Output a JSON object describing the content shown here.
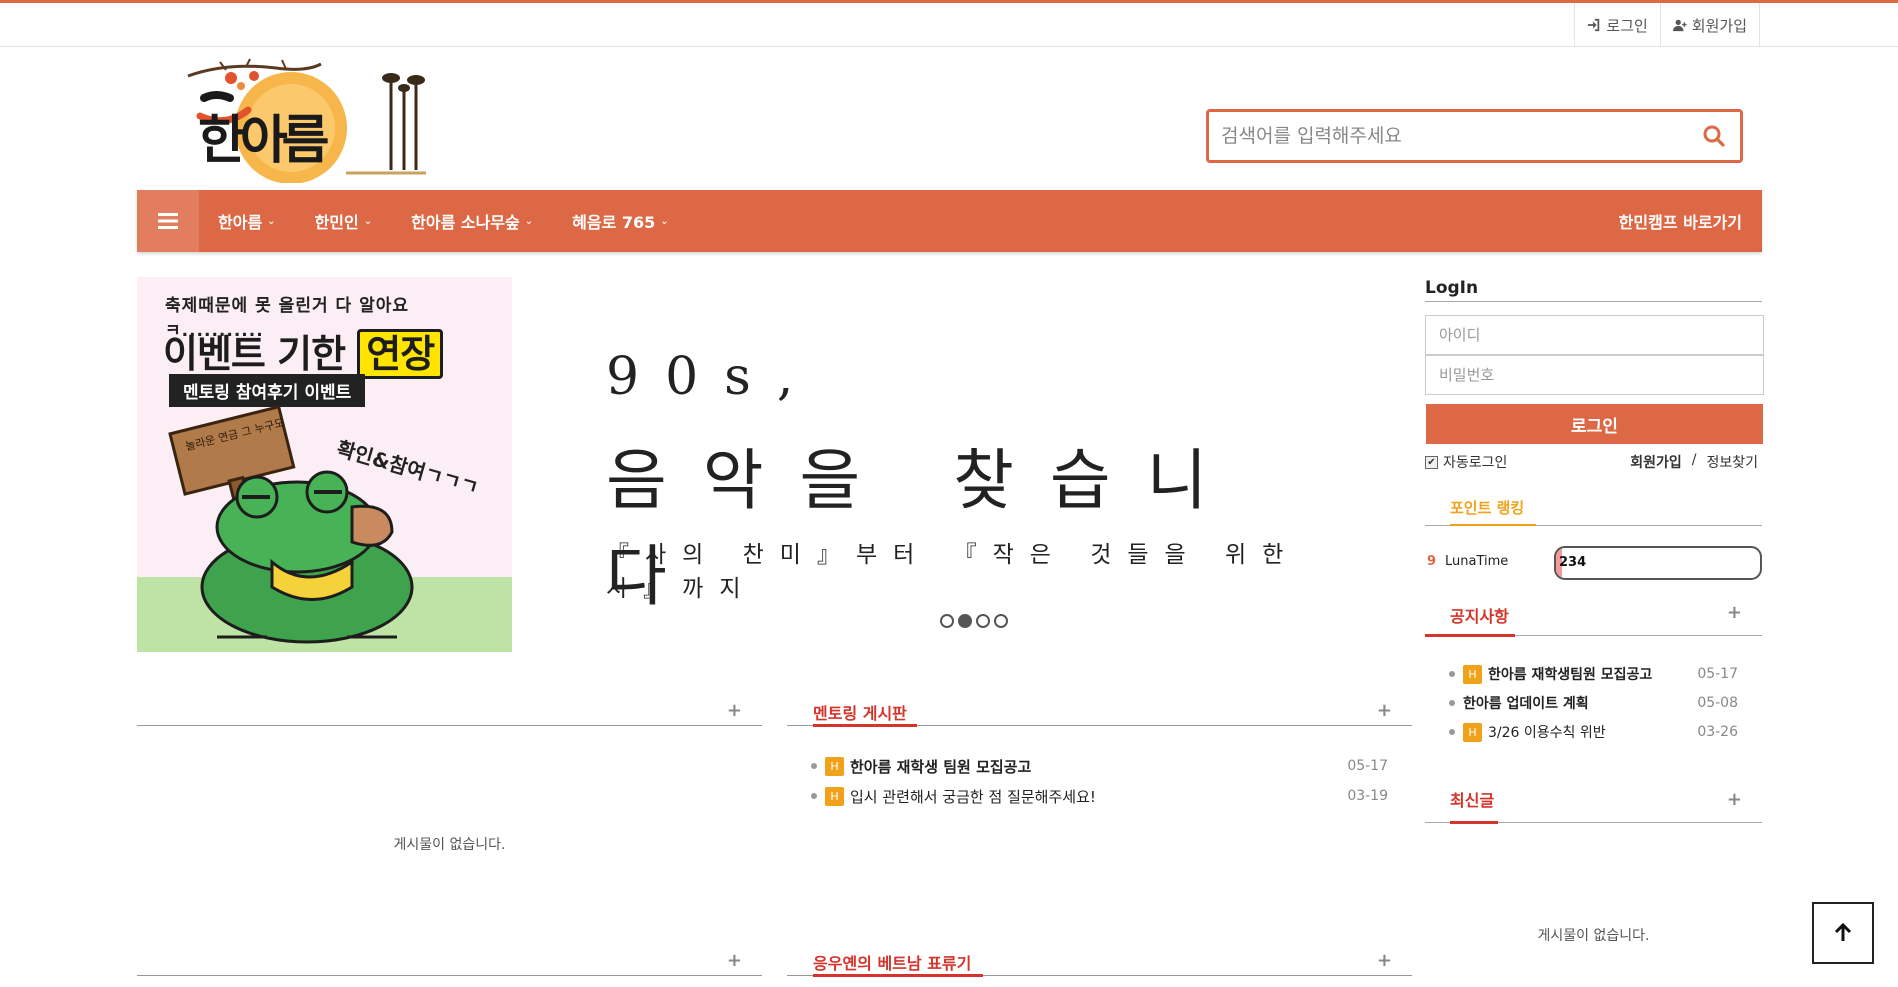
{
  "topbar": {
    "login_label": "로그인",
    "signup_label": "회원가입"
  },
  "search": {
    "placeholder": "검색어를 입력해주세요"
  },
  "nav": {
    "items": [
      {
        "label": "한아름"
      },
      {
        "label": "한민인"
      },
      {
        "label": "한아름 소나무숲"
      },
      {
        "label": "혜음로 765"
      }
    ],
    "camp_link": "한민캠프 바로가기"
  },
  "banner": {
    "small_text": "축제때문에 못 올린거 다 알아요 ㅋ...........",
    "title": "이벤트 기한",
    "title_highlight": "연장",
    "subtitle": "멘토링 참여후기 이벤트",
    "side_text": "확인&참여ㄱㄱㄱ",
    "sign_text": "놀라운 연금 그 누구도 관심을 주지 않았다"
  },
  "hero": {
    "line1": "90s,",
    "line2": "음악을 찾습니다",
    "line3": "『사의 찬미』부터 『작은 것들을 위한 시』까지",
    "slides": [
      false,
      true,
      false,
      false
    ]
  },
  "boards": {
    "left_top": {
      "title": "",
      "plus": "+",
      "empty": "게시물이 없습니다."
    },
    "mentoring": {
      "title": "멘토링 게시판",
      "plus": "+",
      "posts": [
        {
          "badge": "H",
          "title": "한아름 재학생 팀원 모집공고",
          "date": "05-17",
          "bold": true
        },
        {
          "badge": "H",
          "title": "입시 관련해서 궁금한 점 질문해주세요!",
          "date": "03-19",
          "bold": false
        }
      ]
    },
    "left_bottom": {
      "title": "",
      "plus": "+"
    },
    "vietnam": {
      "title": "응우옌의 베트남 표류기",
      "plus": "+"
    }
  },
  "sidebar": {
    "login_title": "LogIn",
    "id_placeholder": "아이디",
    "pw_placeholder": "비밀번호",
    "login_button": "로그인",
    "auto_login": "자동로그인",
    "signup": "회원가입",
    "separator": "/",
    "find_info": "정보찾기",
    "ranking_tab": "포인트 랭킹",
    "ranking": [
      {
        "rank": "9",
        "name": "LunaTime",
        "points": "234",
        "fill": 0.03
      }
    ],
    "notice": {
      "title": "공지사항",
      "plus": "+",
      "posts": [
        {
          "badge": "H",
          "title": "한아름 재학생팀원 모집공고",
          "date": "05-17"
        },
        {
          "badge": "",
          "title": "한아름 업데이트 계획",
          "date": "05-08"
        },
        {
          "badge": "H",
          "title": "3/26 이용수칙 위반",
          "date": "03-26"
        }
      ]
    },
    "recent": {
      "title": "최신글",
      "plus": "+",
      "empty": "게시물이 없습니다."
    }
  },
  "colors": {
    "accent": "#dd6845",
    "badge": "#f0a21a",
    "board_title": "#d4342a"
  }
}
